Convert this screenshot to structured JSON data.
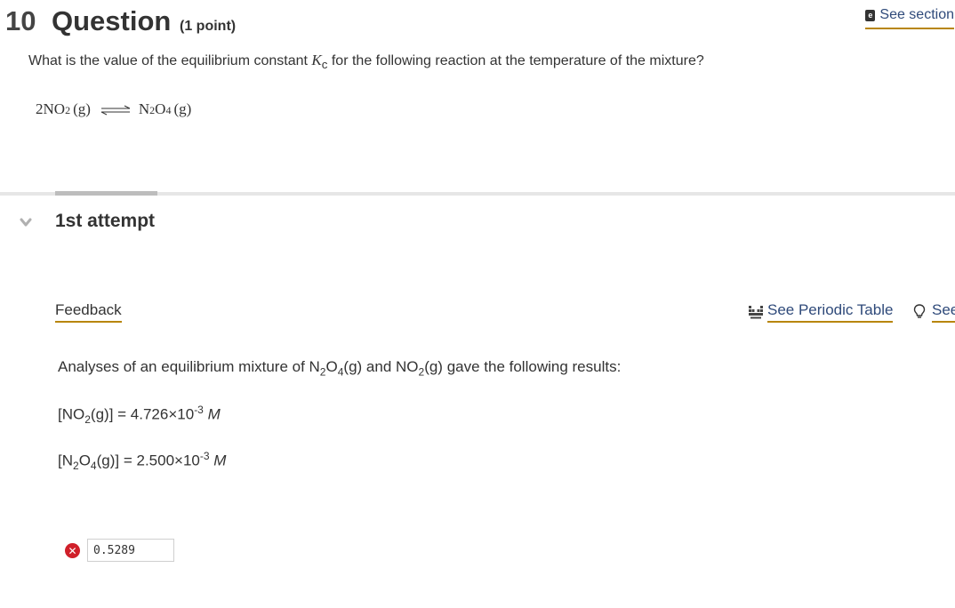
{
  "question": {
    "number": "10",
    "word": "Question",
    "points": "(1 point)",
    "see_section": "See section",
    "prompt_before": "What is the value of the equilibrium constant ",
    "prompt_k": "K",
    "prompt_k_sub": "c",
    "prompt_after": " for the following reaction at the temperature of the mixture?"
  },
  "equation": {
    "lhs_coef": "2NO",
    "lhs_sub": "2",
    "lhs_state": "(g)",
    "rhs_n": "N",
    "rhs_n_sub": "2",
    "rhs_o": "O",
    "rhs_o_sub": "4",
    "rhs_state": "(g)"
  },
  "attempt": {
    "title": "1st attempt"
  },
  "feedback": {
    "label": "Feedback",
    "periodic_table": "See Periodic Table",
    "hint": "See Hint"
  },
  "analysis": {
    "intro_1": "Analyses of an equilibrium mixture of N",
    "intro_sub1": "2",
    "intro_2": "O",
    "intro_sub2": "4",
    "intro_3": "(g) and NO",
    "intro_sub3": "2",
    "intro_4": "(g) gave the following results:",
    "no2_open": "[NO",
    "no2_sub": "2",
    "no2_rest": "(g)] = 4.726×10",
    "no2_exp": "-3",
    "no2_unit": "M",
    "n2o4_open": "[N",
    "n2o4_sub1": "2",
    "n2o4_mid": "O",
    "n2o4_sub2": "4",
    "n2o4_rest": "(g)] = 2.500×10",
    "n2o4_exp": "-3",
    "n2o4_unit": "M"
  },
  "answer": {
    "value": "0.5289",
    "status": "incorrect"
  },
  "colors": {
    "underline": "#b8860b",
    "link": "#2f4a7a",
    "error": "#d0202a"
  }
}
